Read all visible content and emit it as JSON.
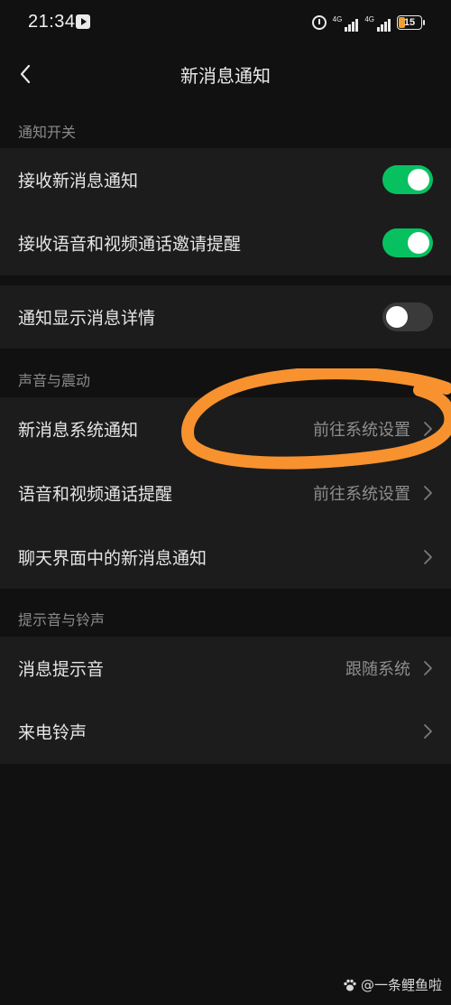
{
  "status_bar": {
    "time": "21:34",
    "network_1": "4G",
    "network_2": "4G",
    "battery": "15",
    "battery_level_percent": 15
  },
  "header": {
    "title": "新消息通知",
    "back_icon": "chevron-left-icon"
  },
  "sections": [
    {
      "label": "通知开关",
      "rows": [
        {
          "label": "接收新消息通知",
          "type": "toggle",
          "on": true
        },
        {
          "label": "接收语音和视频通话邀请提醒",
          "type": "toggle",
          "on": true
        }
      ]
    },
    {
      "label": "",
      "rows": [
        {
          "label": "通知显示消息详情",
          "type": "toggle",
          "on": false
        }
      ]
    },
    {
      "label": "声音与震动",
      "rows": [
        {
          "label": "新消息系统通知",
          "type": "link",
          "value": "前往系统设置"
        },
        {
          "label": "语音和视频通话提醒",
          "type": "link",
          "value": "前往系统设置"
        },
        {
          "label": "聊天界面中的新消息通知",
          "type": "link",
          "value": ""
        }
      ]
    },
    {
      "label": "提示音与铃声",
      "rows": [
        {
          "label": "消息提示音",
          "type": "link",
          "value": "跟随系统"
        },
        {
          "label": "来电铃声",
          "type": "link",
          "value": ""
        }
      ]
    }
  ],
  "watermark": {
    "text": "@一条鲤鱼啦",
    "icon": "paw-icon"
  },
  "colors": {
    "background": "#111111",
    "group_background": "#1c1c1c",
    "toggle_on": "#07c160",
    "toggle_off": "#3a3a3a",
    "annotation": "#f7922f"
  }
}
